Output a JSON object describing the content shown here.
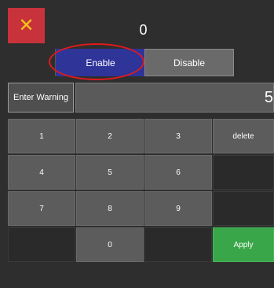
{
  "header": {
    "close_icon": "x-icon",
    "close_color": "#f5c518",
    "value": "0"
  },
  "toggle": {
    "enable_label": "Enable",
    "disable_label": "Disable",
    "selected": "Enable"
  },
  "warning": {
    "label": "Enter Warning",
    "value": "5"
  },
  "keypad": {
    "k1": "1",
    "k2": "2",
    "k3": "3",
    "delete": "delete",
    "k4": "4",
    "k5": "5",
    "k6": "6",
    "k7": "7",
    "k8": "8",
    "k9": "9",
    "k0": "0",
    "apply": "Apply"
  },
  "colors": {
    "close_bg": "#c8323b",
    "enable_bg": "#2f3499",
    "apply_bg": "#3aa64a",
    "highlight": "#e01a1a"
  }
}
